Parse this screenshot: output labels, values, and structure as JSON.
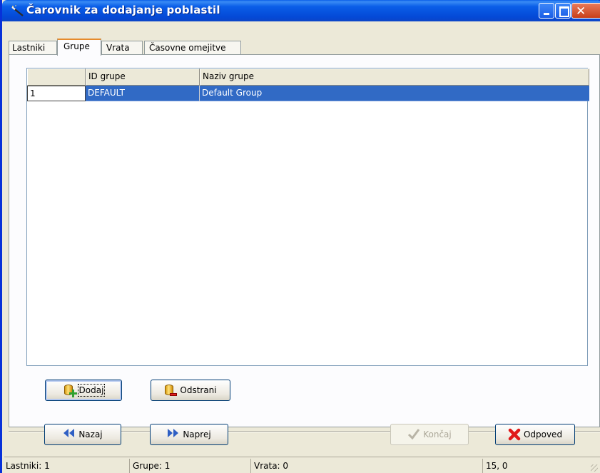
{
  "window": {
    "title": "Čarovnik za dodajanje poblastil",
    "close_glyph": "✕",
    "icon": "wand-icon"
  },
  "tabs": [
    {
      "label": "Lastniki",
      "active": false
    },
    {
      "label": "Grupe",
      "active": true
    },
    {
      "label": "Vrata",
      "active": false
    },
    {
      "label": "Časovne omejitve",
      "active": false
    }
  ],
  "grid": {
    "columns": [
      "",
      "ID grupe",
      "Naziv grupe"
    ],
    "rows": [
      {
        "num": "1",
        "id": "DEFAULT",
        "name": "Default Group",
        "selected": true
      }
    ]
  },
  "actions": {
    "add_label": "Dodaj",
    "remove_label": "Odstrani"
  },
  "nav": {
    "back_label": "Nazaj",
    "next_label": "Naprej",
    "finish_label": "Končaj",
    "cancel_label": "Odpoved"
  },
  "status": {
    "owners": "Lastniki: 1",
    "groups": "Grupe: 1",
    "doors": "Vrata: 0",
    "coords": "15, 0"
  },
  "colors": {
    "title_bar": "#0a5ee8",
    "selection": "#316ac5",
    "active_tab_accent": "#e68b2c"
  }
}
